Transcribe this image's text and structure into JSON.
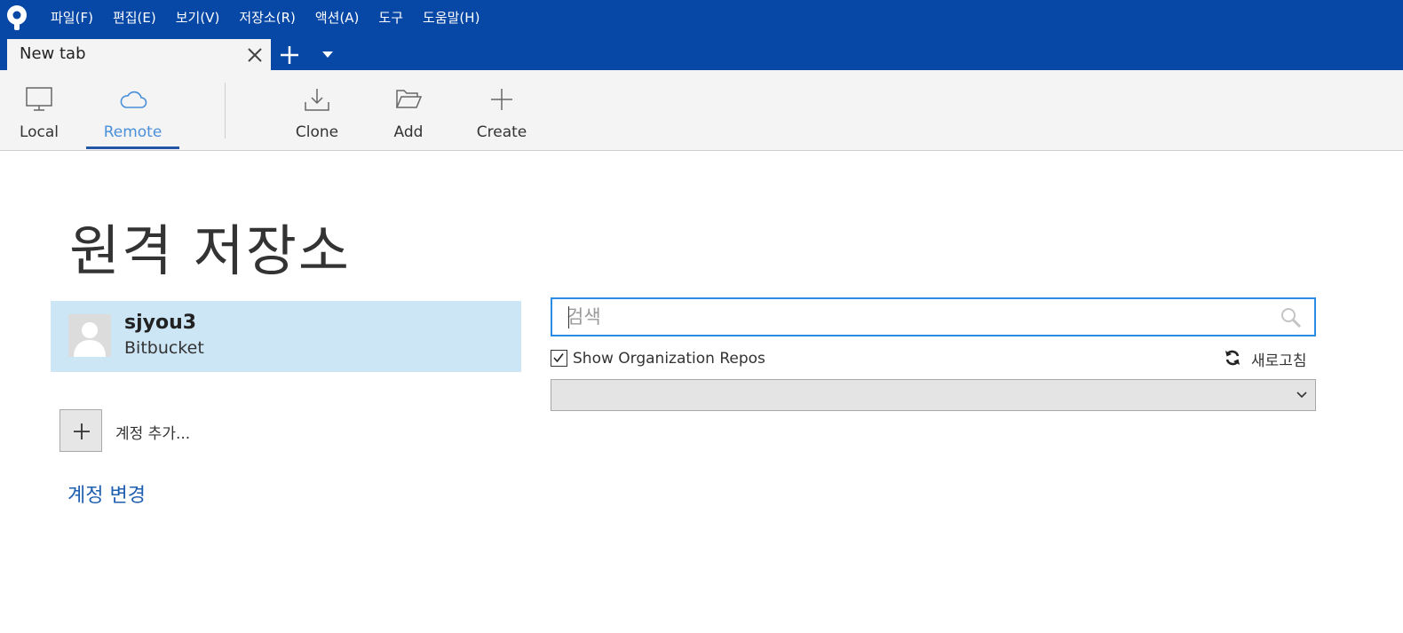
{
  "menubar": {
    "items": [
      "파일(F)",
      "편집(E)",
      "보기(V)",
      "저장소(R)",
      "액션(A)",
      "도구",
      "도움말(H)"
    ]
  },
  "tabs": {
    "active_label": "New tab"
  },
  "toolbar": {
    "local_label": "Local",
    "remote_label": "Remote",
    "clone_label": "Clone",
    "add_label": "Add",
    "create_label": "Create",
    "active_tool": "Remote"
  },
  "page": {
    "title": "원격 저장소"
  },
  "account": {
    "username": "sjyou3",
    "service": "Bitbucket"
  },
  "account_actions": {
    "add_label": "계정 추가...",
    "change_label": "계정 변경"
  },
  "search": {
    "placeholder": "검색",
    "value": ""
  },
  "filters": {
    "show_org_repos_label": "Show Organization Repos",
    "show_org_repos_checked": true,
    "refresh_label": "새로고침",
    "repo_select_value": ""
  },
  "colors": {
    "brand": "#0747a6",
    "selected_row": "#cce6f6",
    "focus_border": "#2b8ce6",
    "link": "#1f5fb0"
  },
  "icons": [
    "sourcetree-logo",
    "close-icon",
    "plus-icon",
    "chevron-down-icon",
    "monitor-icon",
    "cloud-icon",
    "download-icon",
    "folder-open-icon",
    "plus-icon",
    "avatar-icon",
    "search-icon",
    "checkmark-icon",
    "refresh-icon"
  ]
}
